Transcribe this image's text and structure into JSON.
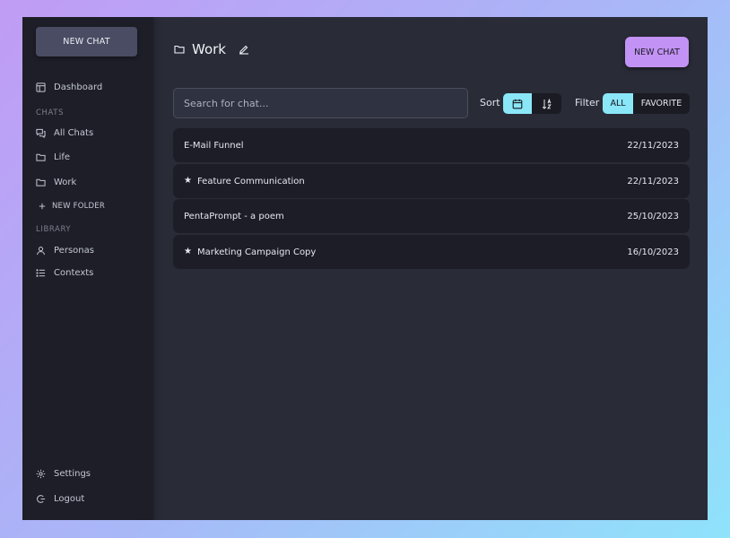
{
  "sidebar": {
    "new_chat_label": "NEW CHAT",
    "dashboard_label": "Dashboard",
    "chats_section": "CHATS",
    "all_chats_label": "All Chats",
    "folders": [
      "Life",
      "Work"
    ],
    "new_folder_label": "NEW FOLDER",
    "library_section": "LIBRARY",
    "personas_label": "Personas",
    "contexts_label": "Contexts",
    "settings_label": "Settings",
    "logout_label": "Logout"
  },
  "header": {
    "title": "Work",
    "new_chat_label": "NEW CHAT"
  },
  "search": {
    "placeholder": "Search for chat..."
  },
  "sort": {
    "label": "Sort",
    "active": "date"
  },
  "filter": {
    "label": "Filter",
    "options": [
      "ALL",
      "FAVORITE"
    ],
    "active": "ALL"
  },
  "chats": [
    {
      "title": "E-Mail Funnel",
      "date": "22/11/2023",
      "favorite": false
    },
    {
      "title": "Feature Communication",
      "date": "22/11/2023",
      "favorite": true
    },
    {
      "title": "PentaPrompt - a poem",
      "date": "25/10/2023",
      "favorite": false
    },
    {
      "title": "Marketing Campaign Copy",
      "date": "16/10/2023",
      "favorite": true
    }
  ],
  "colors": {
    "accent_purple": "#c392f5",
    "accent_cyan": "#8ae7f8",
    "sidebar_bg": "#1d1e27",
    "main_bg": "#292b37"
  }
}
